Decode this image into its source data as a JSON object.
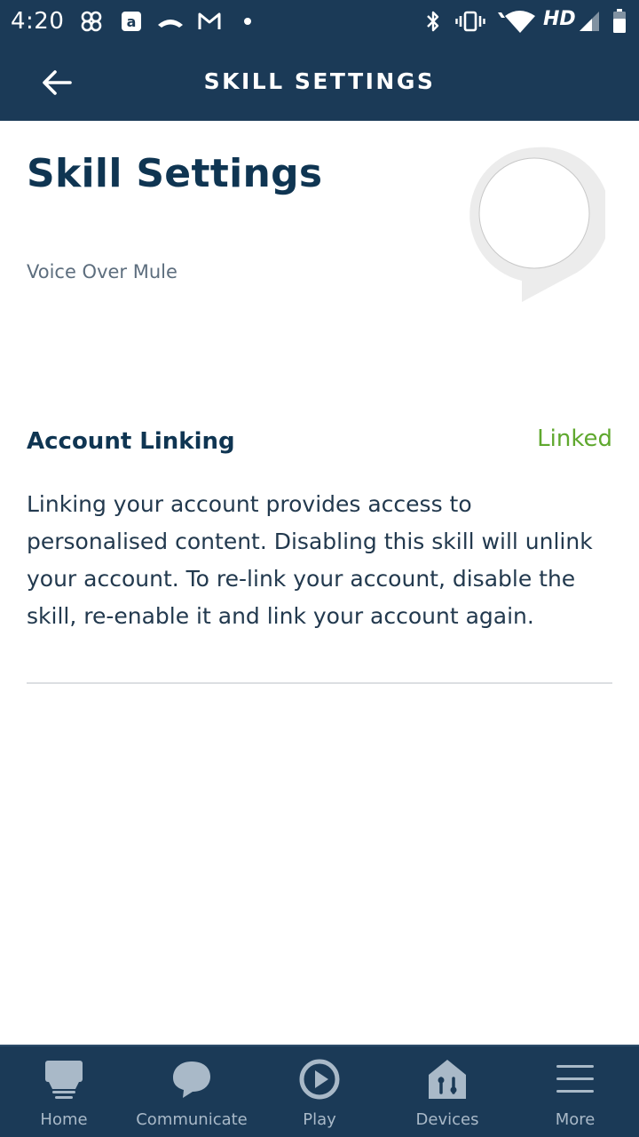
{
  "status_bar": {
    "time": "4:20",
    "network_label": "HD",
    "icons": [
      "pinwheel-icon",
      "amazon-a-icon",
      "missed-call-icon",
      "gmail-icon",
      "notification-dot-icon",
      "bluetooth-icon",
      "vibrate-icon",
      "wifi-icon",
      "signal-icon",
      "battery-icon"
    ]
  },
  "header": {
    "title": "SKILL SETTINGS",
    "back_icon": "arrow-left-icon"
  },
  "main": {
    "page_title": "Skill Settings",
    "skill_name": "Voice Over Mule",
    "skill_logo_icon": "speech-bubble-icon",
    "account_linking": {
      "title": "Account Linking",
      "status": "Linked",
      "description": "Linking your account provides access to personalised content. Disabling this skill will unlink your account. To re-link your account, disable the skill, re-enable it and link your account again."
    }
  },
  "colors": {
    "header_bg": "#1b3a57",
    "title_text": "#0f3552",
    "linked_green": "#5fa82e",
    "nav_label": "#a9b9c8"
  },
  "bottom_nav": {
    "items": [
      {
        "label": "Home",
        "icon": "home-icon"
      },
      {
        "label": "Communicate",
        "icon": "chat-bubble-icon"
      },
      {
        "label": "Play",
        "icon": "play-icon"
      },
      {
        "label": "Devices",
        "icon": "devices-icon"
      },
      {
        "label": "More",
        "icon": "menu-icon"
      }
    ]
  }
}
